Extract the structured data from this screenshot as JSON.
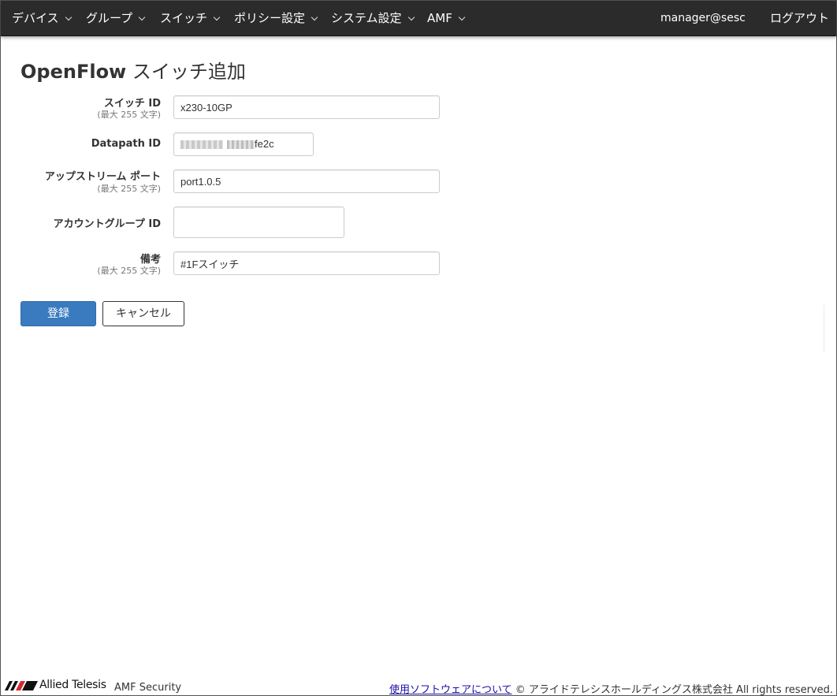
{
  "nav": {
    "items": [
      {
        "label": "デバイス"
      },
      {
        "label": "グループ"
      },
      {
        "label": "スイッチ"
      },
      {
        "label": "ポリシー設定"
      },
      {
        "label": "システム設定"
      },
      {
        "label": "AMF"
      }
    ],
    "user": "manager@sesc",
    "logout": "ログアウト"
  },
  "page": {
    "title_en": "OpenFlow",
    "title_ja": " スイッチ追加"
  },
  "form": {
    "switch_id": {
      "label": "スイッチ ID",
      "hint": "(最大 255 文字)",
      "value": "x230-10GP"
    },
    "datapath_id": {
      "label": "Datapath ID",
      "value_visible": "fe2c"
    },
    "upstream_port": {
      "label": "アップストリーム ポート",
      "hint": "(最大 255 文字)",
      "value": "port1.0.5"
    },
    "account_group_id": {
      "label": "アカウントグループ ID",
      "value": ""
    },
    "remarks": {
      "label": "備考",
      "hint": "(最大 255 文字)",
      "value": "#1Fスイッチ"
    }
  },
  "buttons": {
    "register": "登録",
    "cancel": "キャンセル"
  },
  "footer": {
    "logo_text": "Allied Telesis",
    "app_name": "AMF Security",
    "about_link": "使用ソフトウェアについて",
    "copyright": " © アライドテレシスホールディングス株式会社 All rights reserved."
  },
  "colors": {
    "navbar": "#2b2b2b",
    "primary": "#3a7bbf",
    "logo_red": "#d7282f"
  }
}
